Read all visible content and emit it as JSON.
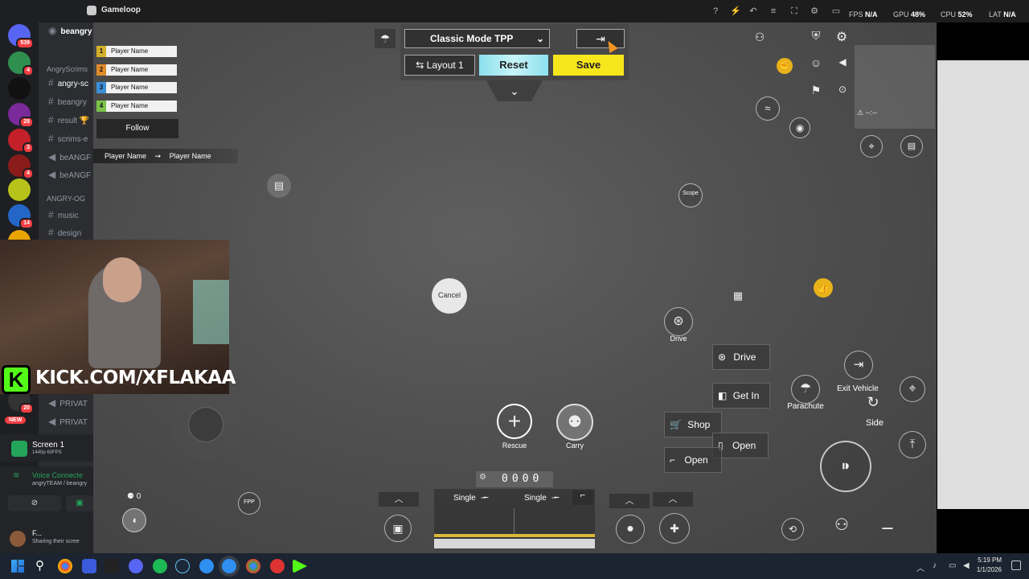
{
  "titlebar": {
    "app_title": "Gameloop",
    "fps_label": "FPS",
    "fps_value": "N/A",
    "gpu_label": "GPU",
    "gpu_value": "48%",
    "cpu_label": "CPU",
    "cpu_value": "52%",
    "lat_label": "LAT",
    "lat_value": "N/A"
  },
  "discord": {
    "server_badges": [
      "539",
      "4",
      "28",
      "3",
      "4",
      "14"
    ],
    "channels": [
      {
        "icon": "hash",
        "name": "beangry"
      },
      {
        "icon": "hash",
        "name": "angry-sc"
      },
      {
        "icon": "hash",
        "name": "beangry"
      },
      {
        "icon": "hash",
        "name": "result 🏆"
      },
      {
        "icon": "hash",
        "name": "scrims-e"
      },
      {
        "icon": "speaker",
        "name": "beANGF"
      },
      {
        "icon": "speaker",
        "name": "beANGF"
      },
      {
        "icon": "hash",
        "name": "music"
      },
      {
        "icon": "hash",
        "name": "design"
      },
      {
        "icon": "speaker",
        "name": "PRIVAT"
      },
      {
        "icon": "speaker",
        "name": "PRIVAT"
      }
    ],
    "category_1": "AngryScrims",
    "category_2": "ANGRY-OG",
    "new_badge": "NEW",
    "badge_20": "20",
    "screen_share": {
      "title": "Screen 1",
      "subtitle": "1440p 60FPS"
    },
    "voice": {
      "title": "Voice Connecte",
      "subtitle": "angryTEAM / beangry"
    },
    "user": {
      "name": "F...",
      "status": "Sharing their scree"
    }
  },
  "team": {
    "players": [
      {
        "num": "1",
        "name": "Player Name",
        "color": "#d4b12c"
      },
      {
        "num": "2",
        "name": "Player Name",
        "color": "#e08a2a"
      },
      {
        "num": "3",
        "name": "Player Name",
        "color": "#3a8fd8"
      },
      {
        "num": "4",
        "name": "Player Name",
        "color": "#7cc24a"
      }
    ],
    "follow_label": "Follow",
    "feed_left": "Player Name",
    "feed_right": "Player Name"
  },
  "controls": {
    "mode": "Classic Mode TPP",
    "layout": "Layout 1",
    "reset": "Reset",
    "save": "Save"
  },
  "hud": {
    "scope": "Scope",
    "cancel": "Cancel",
    "drive_icon_label": "Drive",
    "drive_btn": "Drive",
    "get_in": "Get In",
    "shop": "Shop",
    "open_1": "Open",
    "open_2": "Open",
    "parachute": "Parachute",
    "exit_vehicle": "Exit Vehicle",
    "side": "Side",
    "rescue": "Rescue",
    "carry": "Carry",
    "ammo_counter": "0000",
    "weapon_1_mode": "Single",
    "weapon_2_mode": "Single",
    "grenade_count": "0",
    "fpp": "FPP",
    "ping_text": "--:--"
  },
  "stream": {
    "kick_url": "KICK.COM/XFLAKAA",
    "kick_logo": "K"
  },
  "taskbar": {
    "time": "5:19 PM",
    "date": "1/1/2026"
  },
  "colors": {
    "save": "#f6e61c",
    "reset": "#8ce0ee",
    "kick": "#53fc18",
    "discord_badge": "#f23f43"
  }
}
